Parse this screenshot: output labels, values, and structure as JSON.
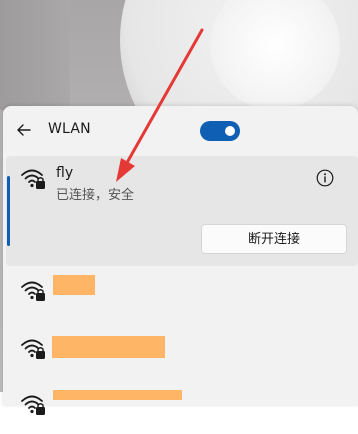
{
  "panel": {
    "title": "WLAN",
    "wifi_enabled": true,
    "accent_color": "#0f5fb5"
  },
  "connected_network": {
    "name": "fly",
    "status": "已连接，安全",
    "icon": "wifi-secured-icon",
    "info_icon": "info-icon",
    "disconnect_label": "断开连接"
  },
  "other_networks": [
    {
      "icon": "wifi-secured-icon",
      "name_redacted": true
    },
    {
      "icon": "wifi-secured-icon",
      "name_redacted": true
    },
    {
      "icon": "wifi-secured-icon",
      "name_redacted": true
    }
  ],
  "annotation": {
    "type": "arrow",
    "color": "#e53935"
  }
}
